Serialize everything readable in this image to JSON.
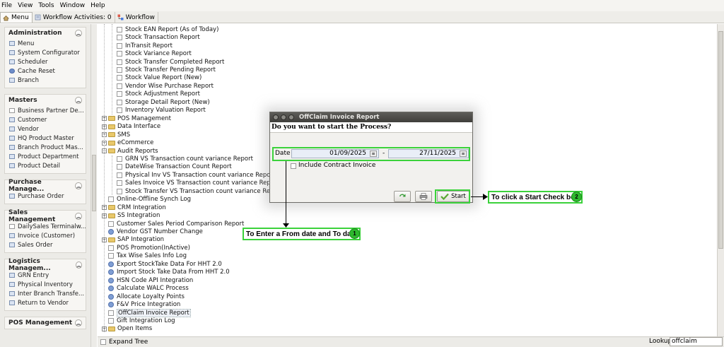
{
  "menubar": [
    "File",
    "View",
    "Tools",
    "Window",
    "Help"
  ],
  "tabs": [
    {
      "label": "Menu",
      "active": true
    },
    {
      "label": "Workflow Activities: 0"
    },
    {
      "label": "Workflow"
    }
  ],
  "sidebar": {
    "groups": [
      {
        "title": "Administration",
        "items": [
          "Menu",
          "System Configurator",
          "Scheduler",
          "Cache Reset",
          "Branch"
        ]
      },
      {
        "title": "Masters",
        "items": [
          "Business Partner De...",
          "Customer",
          "Vendor",
          "HQ Product Master",
          "Branch Product Mas...",
          "Product Department",
          "Product Detail"
        ]
      },
      {
        "title": "Purchase Manage...",
        "items": [
          "Purchase Order"
        ]
      },
      {
        "title": "Sales Management",
        "items": [
          "DailySales Terminalw...",
          "Invoice (Customer)",
          "Sales Order"
        ]
      },
      {
        "title": "Logistics Managem...",
        "items": [
          "GRN Entry",
          "Physical Inventory",
          "Inter Branch Transfe...",
          "Return to Vendor"
        ]
      },
      {
        "title": "POS Management",
        "items": []
      }
    ]
  },
  "tree": {
    "stock_reports": [
      "Stock EAN Report (As of Today)",
      "Stock Transaction Report",
      "InTransit Report",
      "Stock Variance Report",
      "Stock Transfer Completed Report",
      "Stock Transfer Pending Report",
      "Stock Value Report (New)",
      "Vendor Wise Purchase Report",
      "Stock Adjustment Report",
      "Storage Detail Report (New)",
      "Inventory Valuation Report"
    ],
    "folders_a": [
      "POS Management",
      "Data Interface",
      "SMS",
      "eCommerce"
    ],
    "audit_folder": "Audit Reports",
    "audit_reports": [
      "GRN VS Transaction count variance Report",
      "DateWise Transaction Count Report",
      "Physical Inv VS Transaction count variance Report",
      "Sales Invoice VS Transaction count variance Report",
      "Stock Transfer VS Transaction count variance Report"
    ],
    "root_items": [
      {
        "label": "Online-Offline Synch Log",
        "kind": "doc"
      },
      {
        "label": "CRM Integration",
        "kind": "folder"
      },
      {
        "label": "SS Integration",
        "kind": "folder"
      },
      {
        "label": "Customer Sales Period Comparison Report",
        "kind": "doc"
      },
      {
        "label": "Vendor GST Number Change",
        "kind": "process"
      },
      {
        "label": "SAP Integration",
        "kind": "folder"
      },
      {
        "label": "POS Promotion(InActive)",
        "kind": "doc"
      },
      {
        "label": "Tax Wise Sales Info Log",
        "kind": "doc"
      },
      {
        "label": "Export StockTake Data For HHT 2.0",
        "kind": "process"
      },
      {
        "label": "Import Stock Take Data From HHT 2.0",
        "kind": "process"
      },
      {
        "label": "HSN Code API Integration",
        "kind": "process"
      },
      {
        "label": "Calculate WALC Process",
        "kind": "process"
      },
      {
        "label": "Allocate Loyalty Points",
        "kind": "process"
      },
      {
        "label": "F&V Price Integration",
        "kind": "process"
      },
      {
        "label": "OffClaim Invoice Report",
        "kind": "doc",
        "selected": true
      },
      {
        "label": "Gift Integration Log",
        "kind": "doc"
      },
      {
        "label": "Open Items",
        "kind": "folder"
      }
    ]
  },
  "bottombar": {
    "expand_tree": "Expand Tree",
    "lookup_label": "Lookup",
    "lookup_value": "offclaim"
  },
  "dialog": {
    "title": "OffClaim Invoice Report",
    "message": "Do you want to start the Process?",
    "date_label": "Date",
    "date_from": "01/09/2025",
    "date_sep": "-",
    "date_to": "27/11/2025",
    "include_contract": "Include Contract Invoice",
    "start_label": "Start"
  },
  "annotations": {
    "step1_text": "To Enter a From date and To date",
    "step1_num": "1",
    "step2_text": "To click a Start Check box",
    "step2_num": "2",
    "color": "#3bd23b"
  }
}
